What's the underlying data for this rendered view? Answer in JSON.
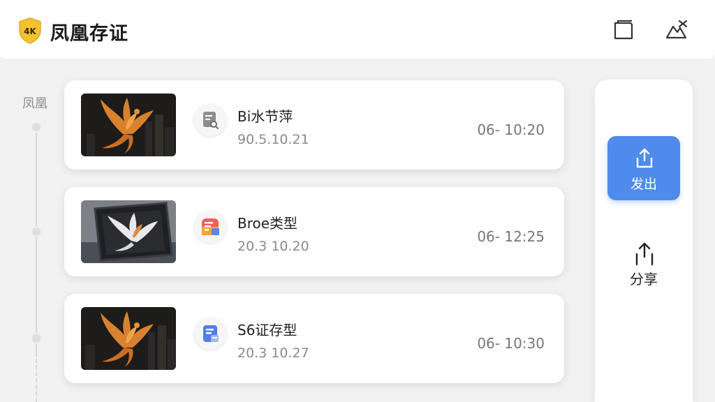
{
  "header": {
    "badge_text": "4K",
    "title": "凤凰存证",
    "icons": [
      "window-icon",
      "close-icon"
    ]
  },
  "timeline": {
    "label": "凤凰"
  },
  "records": [
    {
      "title": "Bi水节萍",
      "date": "90.5.10.21",
      "time": "06- 10:20",
      "icon": "document-search-icon"
    },
    {
      "title": "Broe类型",
      "date": "20.3 10.20",
      "time": "06- 12:25",
      "icon": "document-list-icon"
    },
    {
      "title": "S6证存型",
      "date": "20.3 10.27",
      "time": "06- 10:30",
      "icon": "document-edit-icon"
    }
  ],
  "side": {
    "export_label": "发出",
    "share_label": "分享"
  },
  "colors": {
    "accent": "#4f8bea",
    "badge": "#f2c233",
    "background": "#f2f2f3"
  }
}
